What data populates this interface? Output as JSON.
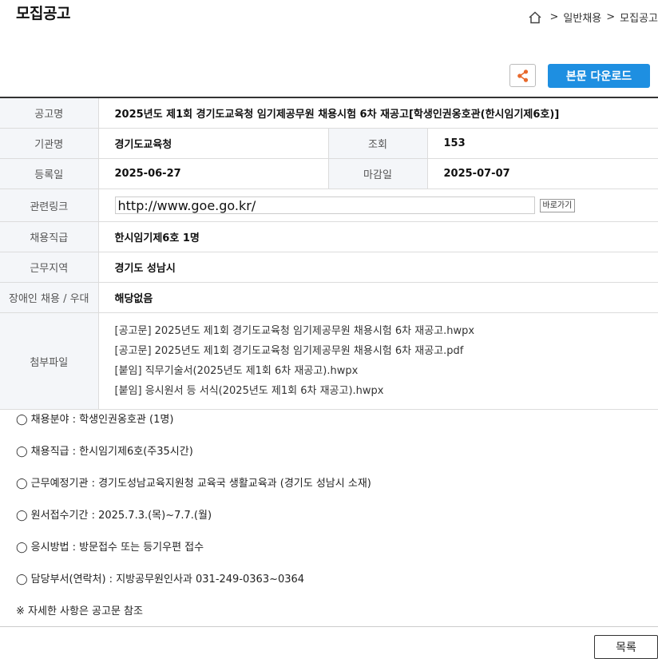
{
  "page": {
    "title": "모집공고"
  },
  "breadcrumb": {
    "items": [
      "일반채용",
      "모집공고"
    ],
    "separator": ">"
  },
  "toolbar": {
    "share_icon": "share-icon",
    "download_label": "본문 다운로드"
  },
  "info": {
    "notice_label": "공고명",
    "notice_value": "2025년도 제1회 경기도교육청 임기제공무원 채용시험 6차 재공고[학생인권옹호관(한시임기제6호)]",
    "org_label": "기관명",
    "org_value": "경기도교육청",
    "views_label": "조회",
    "views_value": "153",
    "reg_label": "등록일",
    "reg_value": "2025-06-27",
    "deadline_label": "마감일",
    "deadline_value": "2025-07-07",
    "link_label": "관련링크",
    "link_value": "http://www.goe.go.kr/",
    "link_button": "바로가기",
    "grade_label": "채용직급",
    "grade_value": "한시임기제6호 1명",
    "region_label": "근무지역",
    "region_value": "경기도 성남시",
    "disability_label": "장애인 채용 / 우대",
    "disability_value": "해당없음",
    "files_label": "첨부파일",
    "files": [
      "[공고문] 2025년도 제1회 경기도교육청 임기제공무원 채용시험 6차 재공고.hwpx",
      "[공고문] 2025년도 제1회 경기도교육청 임기제공무원 채용시험 6차 재공고.pdf",
      "[붙임] 직무기술서(2025년도 제1회 6차 재공고).hwpx",
      "[붙임] 응시원서 등 서식(2025년도 제1회 6차 재공고).hwpx"
    ]
  },
  "details": [
    "◯ 채용분야 : 학생인권옹호관 (1명)",
    "◯ 채용직급 : 한시임기제6호(주35시간)",
    "◯ 근무예정기관 : 경기도성남교육지원청 교육국 생활교육과 (경기도 성남시 소재)",
    "◯ 원서접수기간 : 2025.7.3.(목)~7.7.(월)",
    "◯ 응시방법 : 방문접수 또는 등기우편 접수",
    "◯ 담당부서(연락처) : 지방공무원인사과 031-249-0363~0364",
    "※ 자세한 사항은 공고문 참조"
  ],
  "footer": {
    "list_button": "목록"
  },
  "colors": {
    "accent": "#1e8fe1",
    "share_icon": "#e8692c",
    "header_cell": "#f4f6f9"
  }
}
